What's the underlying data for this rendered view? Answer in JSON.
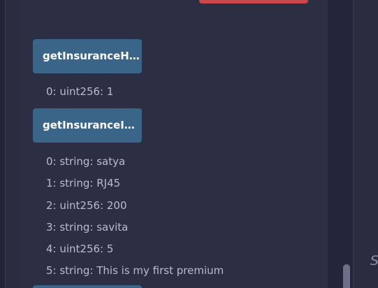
{
  "functions": [
    {
      "label": "getInsuranceH…",
      "outputs": [
        "0: uint256: 1"
      ]
    },
    {
      "label": "getInsuranceIn…",
      "outputs": [
        "0: string: satya",
        "1: string: RJ45",
        "2: uint256: 200",
        "3: string: savita",
        "4: uint256: 5",
        "5: string: This is my first premium"
      ]
    }
  ],
  "right_glyph": "S",
  "colors": {
    "background": "#2a2c3f",
    "panel": "#2c2e44",
    "function_button": "#3a6588",
    "danger_button": "#c8474a",
    "output_text": "#b8bccd"
  }
}
